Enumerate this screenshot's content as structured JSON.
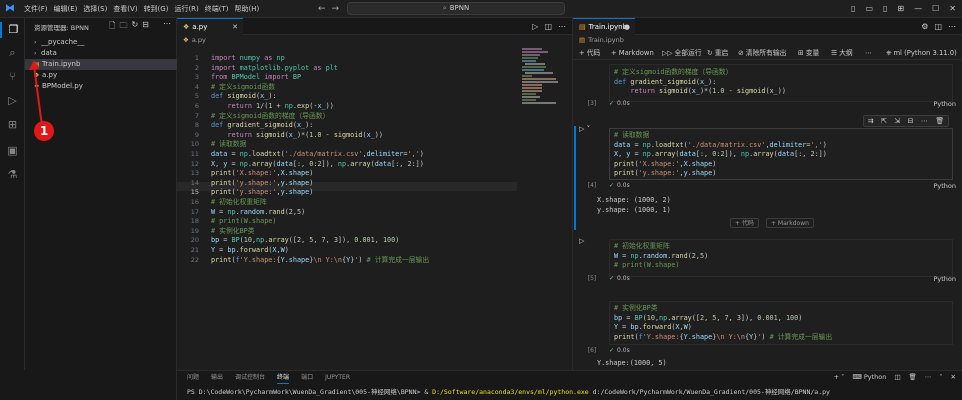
{
  "titlebar": {
    "menu": [
      "文件(F)",
      "编辑(E)",
      "选择(S)",
      "查看(V)",
      "转到(G)",
      "运行(R)",
      "终端(T)",
      "帮助(H)"
    ],
    "search_text": "BPNN"
  },
  "sidebar": {
    "title": "资源管理器: BPNN",
    "items": [
      {
        "label": "__pycache__",
        "type": "folder"
      },
      {
        "label": "data",
        "type": "folder"
      },
      {
        "label": "Train.ipynb",
        "type": "notebook"
      },
      {
        "label": "a.py",
        "type": "python"
      },
      {
        "label": "BPModel.py",
        "type": "python"
      }
    ]
  },
  "editor": {
    "tab_label": "a.py",
    "breadcrumb": "a.py",
    "current_line": 15,
    "line_numbers": [
      "1",
      "2",
      "3",
      "4",
      "5",
      "6",
      "7",
      "8",
      "9",
      "10",
      "11",
      "12",
      "13",
      "14",
      "15",
      "16",
      "17",
      "18",
      "19",
      "20",
      "21",
      "22"
    ]
  },
  "notebook": {
    "tab_label": "Train.ipynb",
    "breadcrumb": "Train.ipynb",
    "toolbar": {
      "add_code": "代码",
      "add_markdown": "Markdown",
      "run_all": "全部运行",
      "restart": "重启",
      "clear_outputs": "清除所有输出",
      "variables": "变量",
      "outline": "大纲",
      "kernel": "ml (Python 3.11.0)"
    },
    "cells": [
      {
        "count": "[3]",
        "time": "0.0s",
        "lang": "Python"
      },
      {
        "count": "[4]",
        "time": "0.0s",
        "lang": "Python",
        "output": [
          "X.shape: (1000, 2)",
          "y.shape: (1000, 1)"
        ]
      },
      {
        "count": "[5]",
        "time": "0.0s",
        "lang": "Python"
      },
      {
        "count": "[6]",
        "time": "0.0s",
        "lang": "Python",
        "output": [
          "Y.shape:(1000, 5)"
        ]
      }
    ],
    "add_cell": {
      "code": "+ 代码",
      "markdown": "+ Markdown"
    }
  },
  "panel": {
    "tabs": [
      "问题",
      "输出",
      "调试控制台",
      "终端",
      "端口",
      "JUPYTER"
    ],
    "active_tab": "终端",
    "shell": "Python",
    "terminal_prefix": "PS D:\\CodeWork\\PycharmWork\\WuenDa_Gradient\\005-神经网络\\BPNN> & ",
    "terminal_exe": "D:/Software/anaconda3/envs/ml/python.exe",
    "terminal_arg": " d:/CodeWork/PycharmWork/WuenDa_Gradient/005-神经网络/BPNN/a.py"
  },
  "annotation": {
    "number": "1",
    "color": "#e01818"
  },
  "colors": {
    "accent": "#0078d4",
    "keyword": "#c586c0",
    "function": "#dcdcaa",
    "string": "#ce9178",
    "comment": "#6a9955",
    "number": "#b5cea8"
  }
}
